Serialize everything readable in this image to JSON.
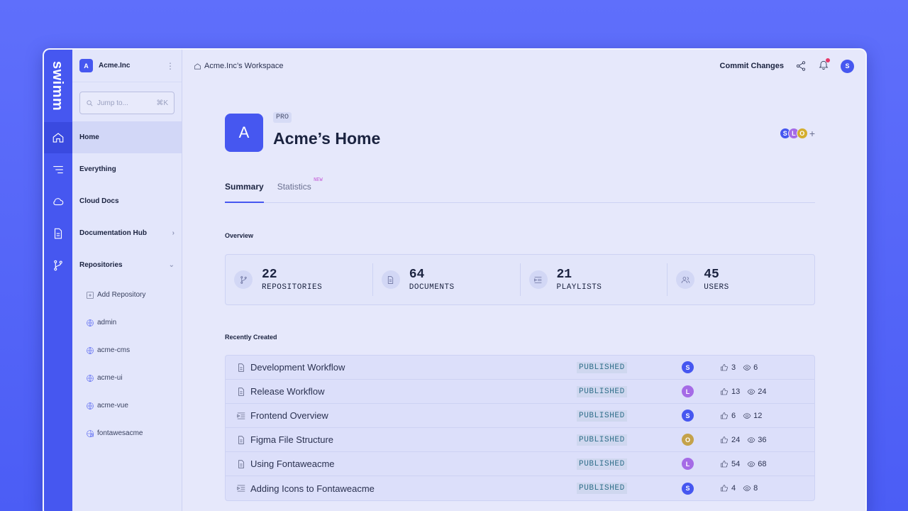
{
  "brand": {
    "logo": "swimm",
    "accent": "#4657f0"
  },
  "workspace": {
    "avatar_letter": "A",
    "name": "Acme.Inc",
    "more_icon": "more-vertical-icon"
  },
  "search": {
    "placeholder": "Jump to...",
    "shortcut": "⌘K"
  },
  "nav": {
    "home": "Home",
    "everything": "Everything",
    "cloud_docs": "Cloud Docs",
    "documentation_hub": "Documentation Hub",
    "repositories": "Repositories"
  },
  "repos": {
    "add": "Add  Repository",
    "items": [
      "admin",
      "acme-cms",
      "acme-ui",
      "acme-vue",
      "fontawesacme"
    ]
  },
  "topbar": {
    "breadcrumb": "Acme.Inc’s Workspace",
    "commit": "Commit Changes",
    "user_letter": "S"
  },
  "hero": {
    "avatar_letter": "A",
    "plan": "PRO",
    "title": "Acme’s Home",
    "collaborators": [
      "S",
      "L",
      "O"
    ],
    "add": "+"
  },
  "tabs": {
    "summary": "Summary",
    "statistics": "Statistics",
    "new": "NEW"
  },
  "overview": {
    "title": "Overview",
    "stats": [
      {
        "value": "22",
        "label": "REPOSITORIES",
        "icon": "git-branch-icon"
      },
      {
        "value": "64",
        "label": "DOCUMENTS",
        "icon": "document-icon"
      },
      {
        "value": "21",
        "label": "PLAYLISTS",
        "icon": "playlist-icon"
      },
      {
        "value": "45",
        "label": "USERS",
        "icon": "users-icon"
      }
    ]
  },
  "recent": {
    "title": "Recently Created",
    "rows": [
      {
        "title": "Development Workflow",
        "status": "PUBLISHED",
        "author": "S",
        "likes": "3",
        "views": "6",
        "type": "document"
      },
      {
        "title": "Release Workflow",
        "status": "PUBLISHED",
        "author": "L",
        "likes": "13",
        "views": "24",
        "type": "document"
      },
      {
        "title": "Frontend Overview",
        "status": "PUBLISHED",
        "author": "S",
        "likes": "6",
        "views": "12",
        "type": "playlist"
      },
      {
        "title": "Figma File Structure",
        "status": "PUBLISHED",
        "author": "O",
        "likes": "24",
        "views": "36",
        "type": "document"
      },
      {
        "title": "Using Fontaweacme",
        "status": "PUBLISHED",
        "author": "L",
        "likes": "54",
        "views": "68",
        "type": "document"
      },
      {
        "title": "Adding Icons to Fontaweacme",
        "status": "PUBLISHED",
        "author": "S",
        "likes": "4",
        "views": "8",
        "type": "playlist"
      }
    ]
  },
  "colors": {
    "S": "#4657f0",
    "L": "#a56be6",
    "O": "#c4a24a"
  }
}
